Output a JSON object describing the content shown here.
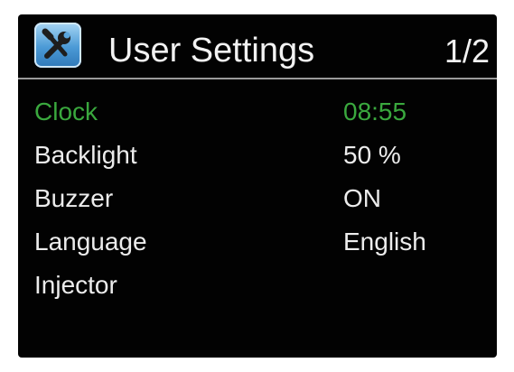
{
  "header": {
    "title": "User Settings",
    "page_indicator": "1/2",
    "icon": "tools-icon"
  },
  "colors": {
    "background": "#020202",
    "text": "#ececec",
    "selected": "#3aa83e",
    "divider": "#9a9a9a"
  },
  "settings": {
    "items": [
      {
        "label": "Clock",
        "value": "08:55",
        "selected": true
      },
      {
        "label": "Backlight",
        "value": "50 %",
        "selected": false
      },
      {
        "label": "Buzzer",
        "value": "ON",
        "selected": false
      },
      {
        "label": "Language",
        "value": "English",
        "selected": false
      },
      {
        "label": "Injector",
        "value": "",
        "selected": false
      }
    ]
  }
}
